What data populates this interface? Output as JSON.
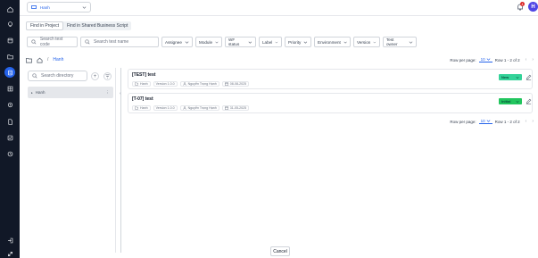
{
  "project": {
    "name": "Hanh"
  },
  "notifications": {
    "count": "4"
  },
  "user": {
    "initial": "H"
  },
  "nav": {
    "rail": [
      {
        "icon": "home-icon"
      },
      {
        "icon": "bulb-icon"
      },
      {
        "icon": "box-icon"
      },
      {
        "icon": "folder-icon"
      },
      {
        "icon": "test-case-icon"
      },
      {
        "icon": "grid-icon"
      },
      {
        "icon": "gear-icon"
      },
      {
        "icon": "document-icon"
      },
      {
        "icon": "checklist-icon"
      },
      {
        "icon": "settings-icon"
      },
      {
        "icon": "login-icon"
      },
      {
        "icon": "expand-icon"
      }
    ]
  },
  "tabs": [
    {
      "label": "Find in Project",
      "active": true
    },
    {
      "label": "Find in Shared Business Script",
      "active": false
    }
  ],
  "filters": {
    "test_code_placeholder": "Search test code",
    "test_name_placeholder": "Search test name",
    "dropdowns": [
      "Assignee",
      "Module",
      "WF status",
      "Label",
      "Priority",
      "Environment",
      "Version",
      "Test owner"
    ]
  },
  "breadcrumb": {
    "separator": "/",
    "current": "Hanh"
  },
  "pagination": {
    "rows_label": "Row per page:",
    "rows_value": "10",
    "range": "Row 1 - 2 of 2"
  },
  "directory": {
    "search_placeholder": "Search directory",
    "add_label": "+",
    "items": [
      {
        "label": "Hanh",
        "more": "⋮"
      }
    ]
  },
  "tests": [
    {
      "title": "[TEST] test",
      "status": "New",
      "status_color": "#34d399",
      "project": "Hanh",
      "version": "Version 1.0.0",
      "owner": "Nguyễn Trọng Hạnh",
      "date": "08-08-2025"
    },
    {
      "title": "[T-07] test",
      "status": "Initial",
      "status_color": "#22c55e",
      "project": "Hanh",
      "version": "Version 1.0.0",
      "owner": "Nguyễn Trọng Hạnh",
      "date": "31-05-2025"
    }
  ],
  "footer": {
    "cancel_label": "Cancel"
  }
}
